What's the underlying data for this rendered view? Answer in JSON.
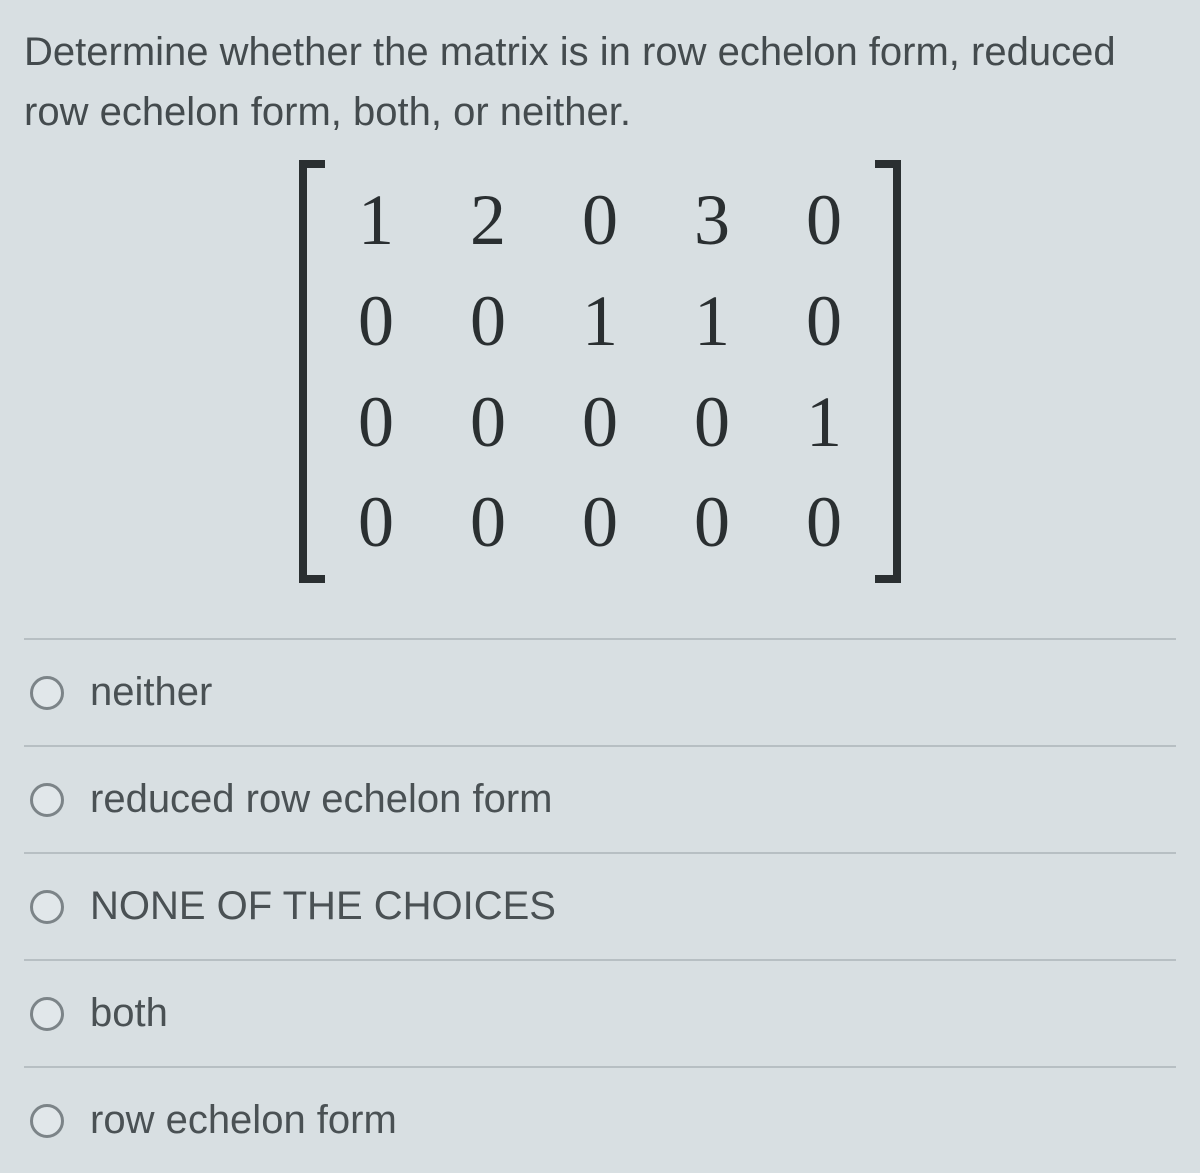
{
  "question": {
    "text": "Determine whether the matrix is in row echelon form, reduced row echelon form, both, or neither."
  },
  "matrix": {
    "rows": [
      [
        "1",
        "2",
        "0",
        "3",
        "0"
      ],
      [
        "0",
        "0",
        "1",
        "1",
        "0"
      ],
      [
        "0",
        "0",
        "0",
        "0",
        "1"
      ],
      [
        "0",
        "0",
        "0",
        "0",
        "0"
      ]
    ]
  },
  "options": [
    {
      "label": "neither"
    },
    {
      "label": "reduced row echelon form"
    },
    {
      "label": "NONE OF THE CHOICES"
    },
    {
      "label": "both"
    },
    {
      "label": "row echelon form"
    }
  ]
}
